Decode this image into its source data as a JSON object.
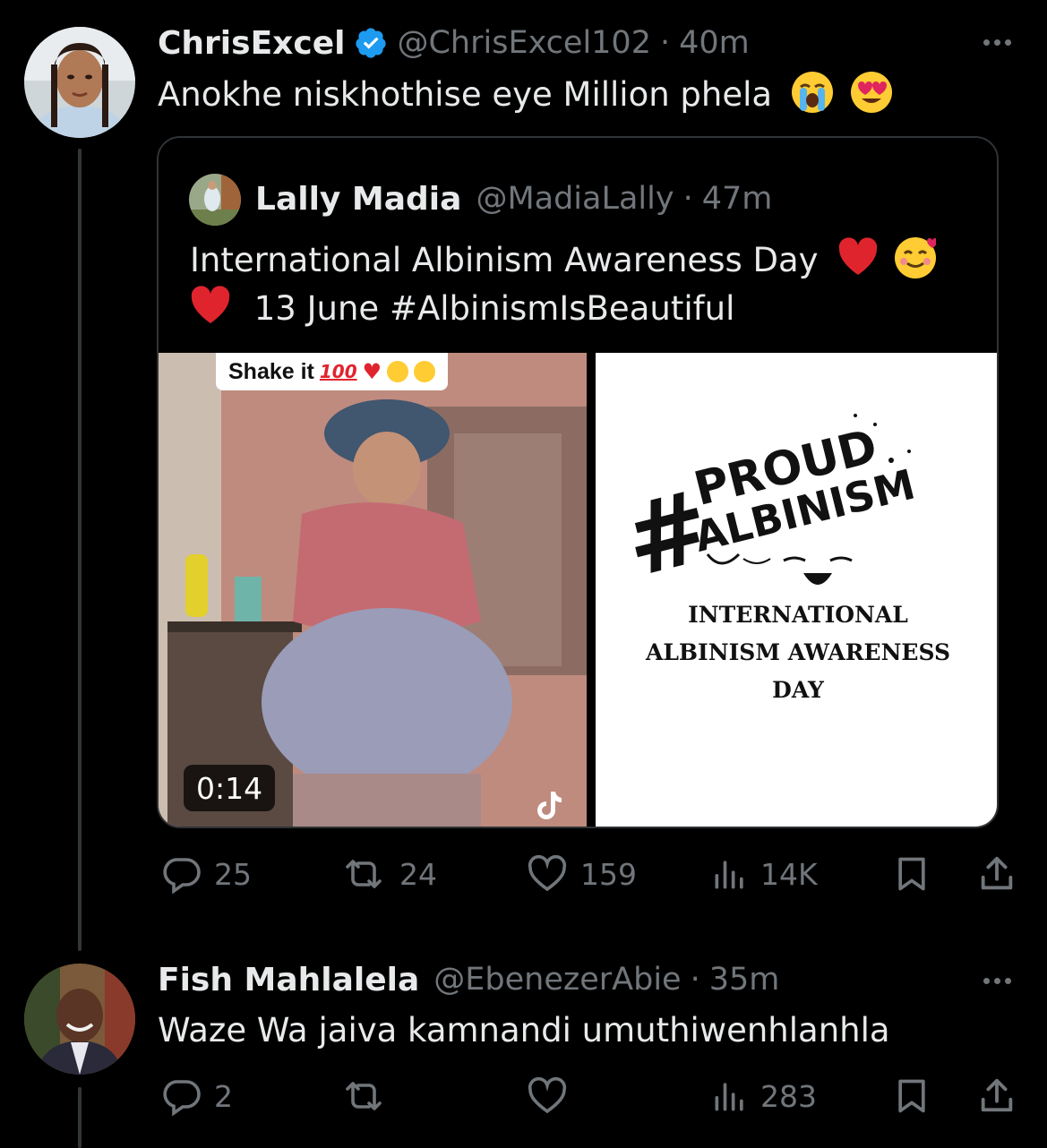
{
  "tweet1": {
    "name": "ChrisExcel",
    "handle": "@ChrisExcel102",
    "separator": "·",
    "time": "40m",
    "text": "Anokhe niskhothise eye Million phela",
    "emojis": [
      "loudly-crying-face",
      "smiling-face-with-heart-eyes"
    ],
    "quote": {
      "name": "Lally Madia",
      "handle": "@MadiaLally",
      "separator": "·",
      "time": "47m",
      "line1": "International Albinism Awareness Day",
      "line2": "13 June #AlbinismIsBeautiful",
      "media_left": {
        "caption": "Shake it",
        "duration": "0:14"
      },
      "media_right": {
        "hashtag": "#",
        "word1": "PROUD",
        "word2": "ALBINISM",
        "line1": "INTERNATIONAL",
        "line2": "ALBINISM AWARENESS",
        "line3": "DAY"
      }
    },
    "actions": {
      "replies": "25",
      "reposts": "24",
      "likes": "159",
      "views": "14K"
    }
  },
  "tweet2": {
    "name": "Fish Mahlalela",
    "handle": "@EbenezerAbie",
    "separator": "·",
    "time": "35m",
    "text": "Waze Wa jaiva kamnandi umuthiwenhlanhla",
    "actions": {
      "replies": "2",
      "reposts": "",
      "likes": "",
      "views": "283"
    }
  },
  "colors": {
    "background": "#000000",
    "text": "#e7e9ea",
    "secondary": "#71767b",
    "border": "#2f3336",
    "verified": "#1d9bf0"
  }
}
